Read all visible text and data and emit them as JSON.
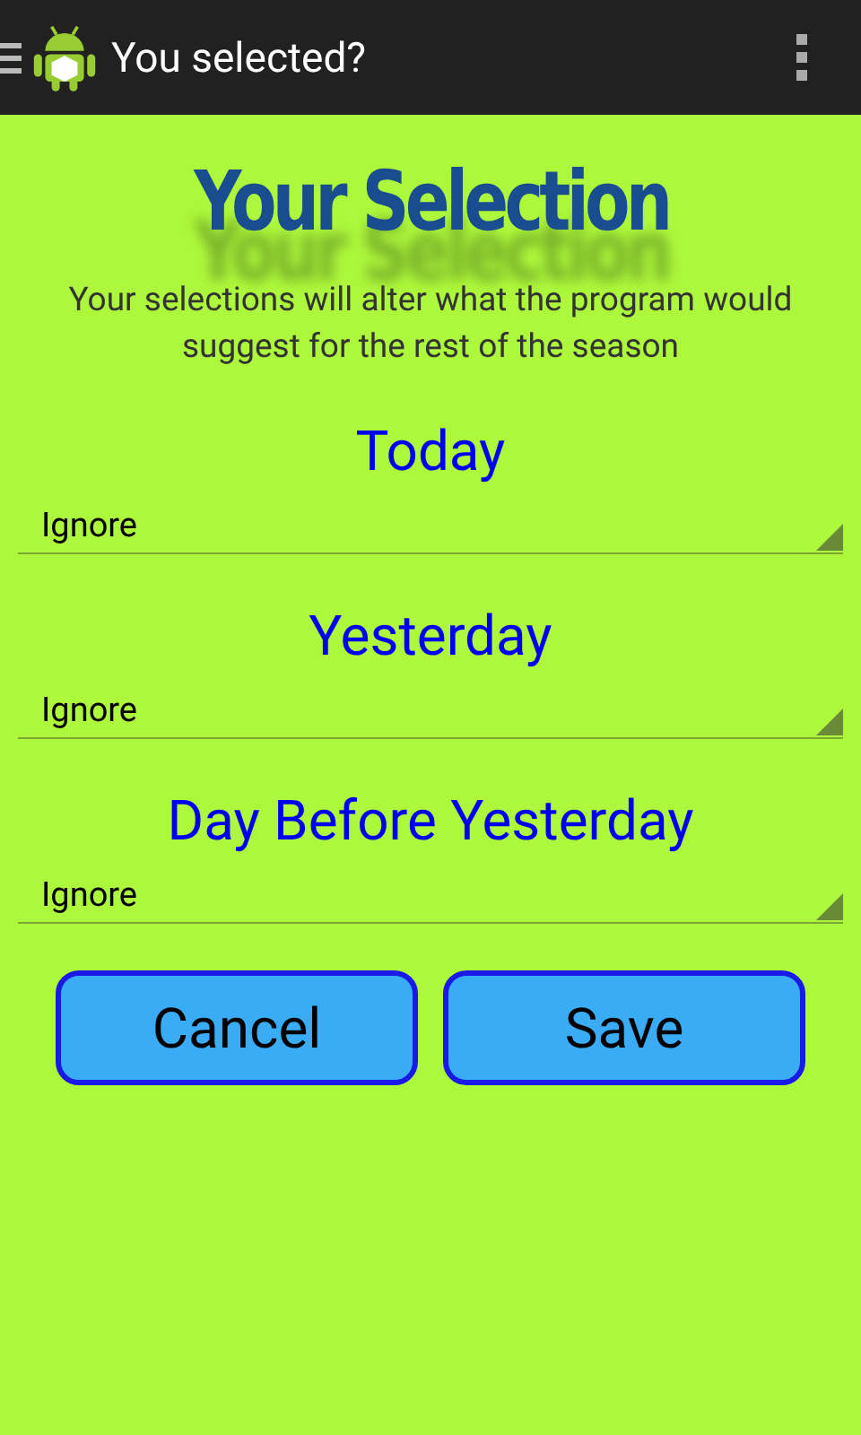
{
  "action_bar": {
    "title": "You selected?"
  },
  "heading": "Your Selection",
  "description": "Your selections will alter what the program would suggest for the rest of the season",
  "fields": [
    {
      "label": "Today",
      "value": "Ignore"
    },
    {
      "label": "Yesterday",
      "value": "Ignore"
    },
    {
      "label": "Day Before Yesterday",
      "value": "Ignore"
    }
  ],
  "buttons": [
    "Cancel",
    "Save"
  ]
}
